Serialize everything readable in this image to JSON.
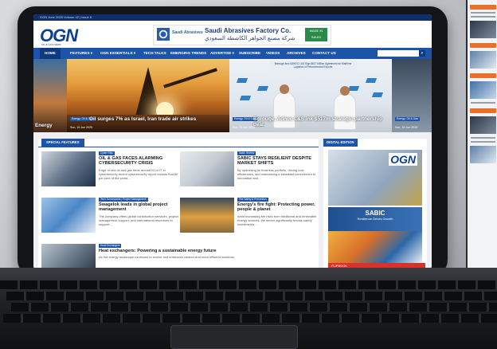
{
  "site": {
    "top_strip": "OGN June 2025 Volume 42 | Issue 6",
    "logo": "OGN",
    "logo_sub": "OIL & GAS NEWS"
  },
  "ad": {
    "brand": "Saudi Abrasives",
    "title": "Saudi Abrasives Factory Co.",
    "arabic": "شركة مصنع الجواهر الكاشطة السعودي",
    "badge": "MADE IN SAUDI"
  },
  "nav": {
    "items": [
      "HOME",
      "FEATURES ▾",
      "OGN ESSENTIALS ▾",
      "TECH TALKS",
      "EMERGING TRENDS",
      "ADVERTISE ▾",
      "SUBSCRIBE",
      "VIDEOS",
      "ARCHIVES",
      "CONTACT US"
    ],
    "search_icon": "search-icon"
  },
  "hero": {
    "left_caption": "Energy",
    "main_tag": "Energy, Oil & Gas",
    "main_title": "Oil surges 7% as Israel, Iran trade air strikes",
    "main_date": "Sun, 15 Jun 2025",
    "right_banner": "Borouge and ADNOC L&S Sign $517 Million Agreement for Maritime Logistics of Petrochemical Exports",
    "right_tag": "Energy, Oil & Gas",
    "right_title": "Borouge, Adnoc L&S ink $517m strategic partnership deal",
    "right_date": "Sun, 15 Jun 2025",
    "edge_tag": "Energy, Oil & Gas",
    "edge_date": "Sun, 15 Jun 2025"
  },
  "features": {
    "heading": "SPECIAL FEATURES",
    "articles": [
      {
        "tag": "Cyber Risk",
        "title": "OIL & GAS FACES ALARMING CYBERSECURITY CRISIS",
        "excerpt": "Edge of mid oil and gas firms around ID or IT in cybersecurity recent cybersecurity report reveals that 80 per cent of the world..."
      },
      {
        "tag": "Sabic Review",
        "title": "SABIC STAYS RESILIENT DESPITE MARKET SHIFTS",
        "excerpt": "By optimising its business portfolio, driving cost efficiencies, and maintaining a steadfast commitment to innovation and..."
      },
      {
        "tag": "Tech Turnarounds | Project Management",
        "title": "Swagelok leads in global project management",
        "excerpt": "The company offers global construction services, project management support, and international resources to support..."
      },
      {
        "tag": "Fire Safety & Prevention",
        "title": "Energy's fire fight: Protecting power, people & planet",
        "excerpt": "Amid increasing fire risks from traditional and renewable energy sources, the sector significantly boosts safety investments..."
      },
      {
        "tag": "Heat Exchangers",
        "title": "Heat exchangers: Powering a sustainable energy future",
        "excerpt": "As the energy landscape continues to evolve and embraces cleaner and more efficient solutions,"
      }
    ]
  },
  "sidebar": {
    "heading": "DIGITAL EDITION",
    "cover_logo": "OGN",
    "cover_brand": "SABIC",
    "cover_subtitle": "Resilience Drives Growth",
    "flipbook": "FLIPBOOK"
  },
  "side_screen": {
    "heads": [
      "Plant Most Read",
      "Top Trade News",
      "Industry News",
      "Top Tech News"
    ]
  },
  "colors": {
    "nav": "#1d54a8",
    "dark_nav": "#0e3a82",
    "accent": "#e8702a",
    "flip": "#d9312b"
  }
}
